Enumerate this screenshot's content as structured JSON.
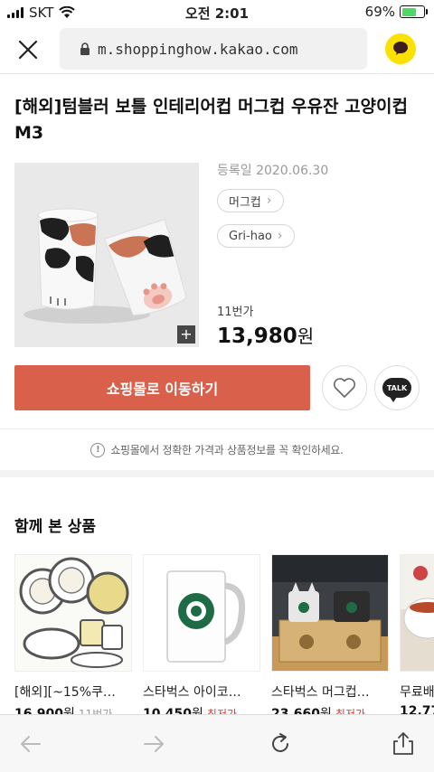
{
  "status_bar": {
    "carrier": "SKT",
    "time": "오전 2:01",
    "battery_percent": "69%",
    "battery_level": 0.69
  },
  "browser": {
    "url": "m.shoppinghow.kakao.com"
  },
  "product": {
    "title": "[해외]텀블러 보틀 인테리어컵 머그컵 우유잔 고양이컵 M3",
    "register_date": "등록일 2020.06.30",
    "tags": [
      {
        "label": "머그컵"
      },
      {
        "label": "Gri-hao"
      }
    ],
    "store": "11번가",
    "price": "13,980",
    "price_unit": "원"
  },
  "actions": {
    "buy_label": "쇼핑몰로 이동하기",
    "talk_label": "TALK"
  },
  "notice": "쇼핑몰에서 정확한 가격과 상품정보를 꼭 확인하세요.",
  "related": {
    "title": "함께 본 상품",
    "items": [
      {
        "name": "[해외][~15%쿠…",
        "price": "16,900",
        "unit": "원",
        "source": "11번가"
      },
      {
        "name": "스타벅스 아이코…",
        "price": "10,450",
        "unit": "원",
        "source": "최저가"
      },
      {
        "name": "스타벅스 머그컵…",
        "price": "23,660",
        "unit": "원",
        "source": "최저가"
      },
      {
        "name": "무료배",
        "price": "12,77",
        "unit": "",
        "source": ""
      }
    ]
  },
  "colors": {
    "accent": "#d9604a",
    "kakao_yellow": "#fae100",
    "lowest_price_red": "#e03c31"
  }
}
